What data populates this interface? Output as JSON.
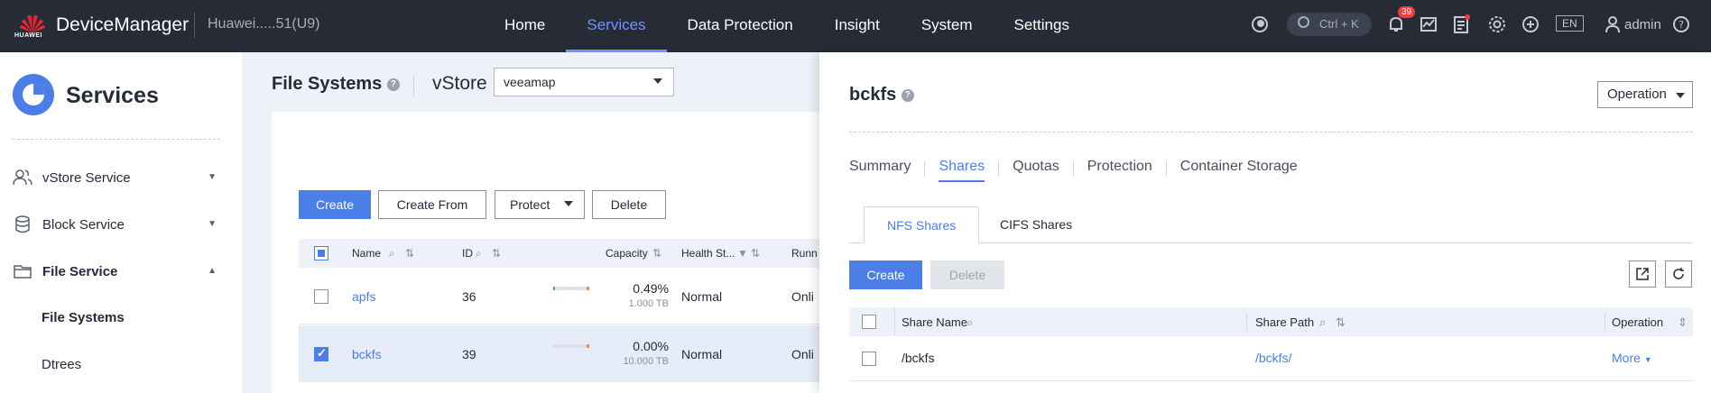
{
  "topbar": {
    "brand": "HUAWEI",
    "app_name": "DeviceManager",
    "device": "Huawei.....51(U9)",
    "nav": [
      "Home",
      "Services",
      "Data Protection",
      "Insight",
      "System",
      "Settings"
    ],
    "search_shortcut": "Ctrl + K",
    "alarm_count": "39",
    "language": "EN",
    "user": "admin"
  },
  "sidebar": {
    "title": "Services",
    "items": [
      {
        "label": "vStore Service",
        "icon": "users-icon"
      },
      {
        "label": "Block Service",
        "icon": "database-icon"
      },
      {
        "label": "File Service",
        "icon": "folder-icon"
      }
    ],
    "subitems": [
      "File Systems",
      "Dtrees"
    ]
  },
  "main": {
    "title": "File Systems",
    "vstore_label": "vStore",
    "vstore_value": "veeamap",
    "buttons": {
      "create": "Create",
      "create_from": "Create From",
      "protect": "Protect",
      "delete": "Delete"
    },
    "columns": {
      "name": "Name",
      "id": "ID",
      "capacity": "Capacity",
      "health": "Health St...",
      "running": "Runn"
    },
    "rows": [
      {
        "name": "apfs",
        "id": "36",
        "capacity_pct": "0.49%",
        "capacity_total": "1.000 TB",
        "health": "Normal",
        "running": "Onli"
      },
      {
        "name": "bckfs",
        "id": "39",
        "capacity_pct": "0.00%",
        "capacity_total": "10.000 TB",
        "health": "Normal",
        "running": "Onli"
      }
    ]
  },
  "panel": {
    "title": "bckfs",
    "operation": "Operation",
    "tabs": [
      "Summary",
      "Shares",
      "Quotas",
      "Protection",
      "Container Storage"
    ],
    "subtabs": [
      "NFS Shares",
      "CIFS Shares"
    ],
    "buttons": {
      "create": "Create",
      "delete": "Delete"
    },
    "columns": {
      "share_name": "Share Name",
      "share_path": "Share Path",
      "operation": "Operation"
    },
    "rows": [
      {
        "share_name": "/bckfs",
        "share_path": "/bckfs/",
        "action": "More"
      }
    ]
  },
  "colors": {
    "accent": "#4c7ee8",
    "topbar": "#262b36",
    "alarm": "#f23d3d"
  }
}
